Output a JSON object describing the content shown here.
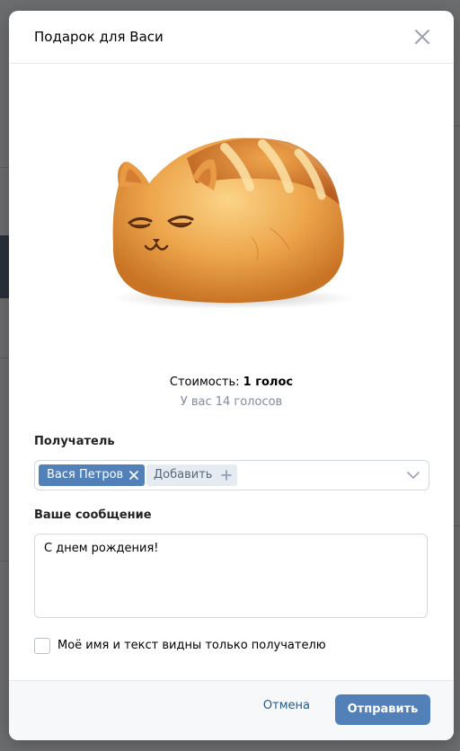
{
  "modal": {
    "title": "Подарок для Васи"
  },
  "gift": {
    "image_name": "bread-cat-gift"
  },
  "cost": {
    "label": "Стоимость: ",
    "value": "1 голос"
  },
  "balance": {
    "text": "У вас 14 голосов"
  },
  "recipient": {
    "label": "Получатель",
    "selected": "Вася Петров",
    "add_label": "Добавить"
  },
  "message": {
    "label": "Ваше сообщение",
    "value": "С днем рождения!"
  },
  "privacy": {
    "label": "Моё имя и текст видны только получателю",
    "checked": false
  },
  "footer": {
    "cancel_label": "Отмена",
    "send_label": "Отправить"
  },
  "colors": {
    "accent": "#5181b8",
    "link": "#2a5885",
    "muted": "#818c99"
  }
}
